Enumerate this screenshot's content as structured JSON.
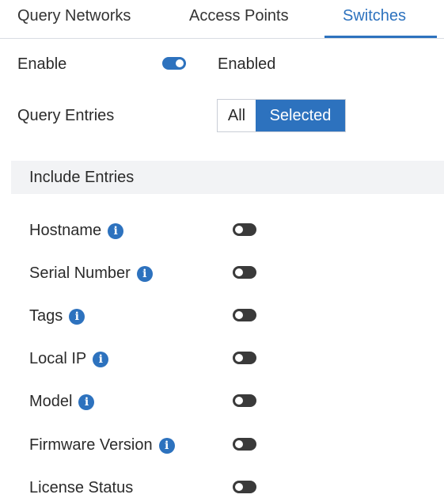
{
  "tabs": [
    {
      "label": "Query Networks",
      "active": false
    },
    {
      "label": "Access Points",
      "active": false
    },
    {
      "label": "Switches",
      "active": true
    }
  ],
  "enable": {
    "label": "Enable",
    "status": "Enabled",
    "on": true
  },
  "query_entries": {
    "label": "Query Entries",
    "options": [
      "All",
      "Selected"
    ],
    "selected": "Selected"
  },
  "include": {
    "title": "Include Entries",
    "items": [
      {
        "label": "Hostname",
        "info_icon": "info-icon",
        "on": false
      },
      {
        "label": "Serial Number",
        "info_icon": "info-icon",
        "on": false
      },
      {
        "label": "Tags",
        "info_icon": "info-icon",
        "on": false
      },
      {
        "label": "Local IP",
        "info_icon": "info-icon",
        "on": false
      },
      {
        "label": "Model",
        "info_icon": "info-icon",
        "on": false
      },
      {
        "label": "Firmware Version",
        "info_icon": "info-icon",
        "on": false
      },
      {
        "label": "License Status",
        "on": false
      }
    ]
  },
  "colors": {
    "accent": "#2d72be",
    "toggle_off": "#3a3a3a",
    "section_bg": "#f2f3f5"
  }
}
